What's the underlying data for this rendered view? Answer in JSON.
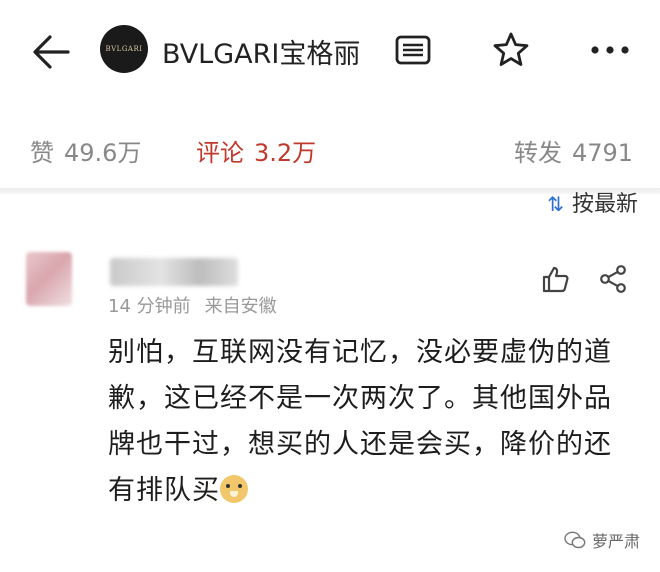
{
  "header": {
    "account_logo_text": "BVLGARI",
    "account_name": "BVLGARI宝格丽"
  },
  "stats": {
    "likes_label": "赞",
    "likes_count": "49.6万",
    "comments_label": "评论",
    "comments_count": "3.2万",
    "reposts_label": "转发",
    "reposts_count": "4791"
  },
  "sort": {
    "label": "按最新"
  },
  "comment": {
    "time": "14 分钟前",
    "location": "来自安徽",
    "text": "别怕，互联网没有记忆，没必要虚伪的道歉，这已经不是一次两次了。其他国外品牌也干过，想买的人还是会买，降价的还有排队买"
  },
  "watermark": {
    "text": "萝严肃"
  },
  "colors": {
    "accent_red": "#c0392b",
    "muted_gray": "#888888",
    "sort_icon_blue": "#2a6fd6"
  },
  "icons": [
    "back-arrow-icon",
    "article-icon",
    "star-icon",
    "more-icon",
    "sort-icon",
    "thumbs-up-icon",
    "share-icon",
    "dog-emoji-icon",
    "wechat-icon"
  ]
}
